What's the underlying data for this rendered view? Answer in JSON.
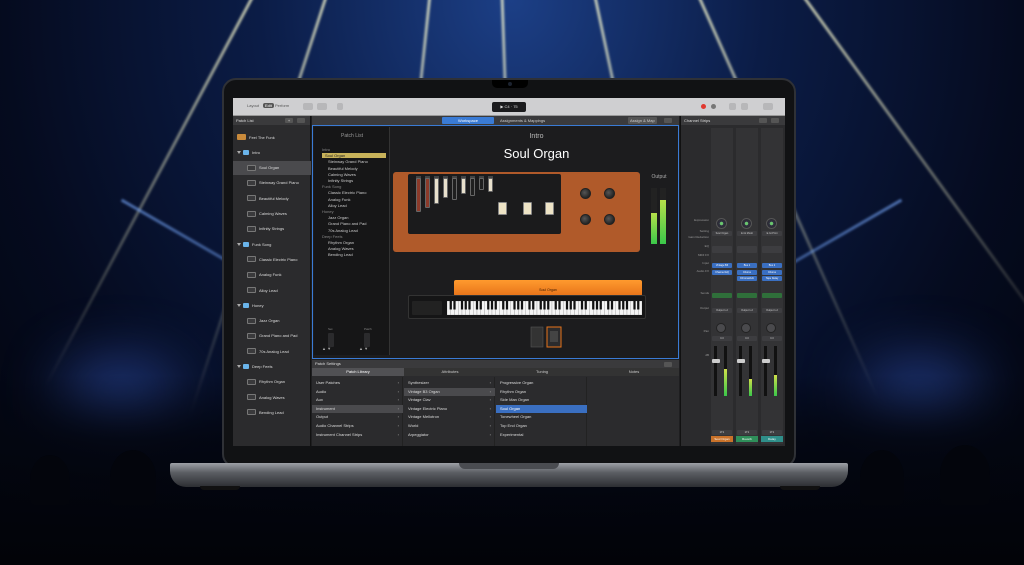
{
  "toolbar": {
    "lcd_text": "▶ C4 · 75",
    "view_segments": [
      "Layout",
      "Edit",
      "Perform"
    ],
    "active_segment": "Edit"
  },
  "patch_list": {
    "title": "Patch List",
    "add_symbol": "+",
    "items": [
      {
        "label": "Feel The Funk",
        "kind": "patch-top",
        "selected": false
      },
      {
        "label": "Intro",
        "kind": "folder",
        "selected": false
      },
      {
        "label": "Soul Organ",
        "kind": "patch",
        "selected": true
      },
      {
        "label": "Steinway Grand Piano",
        "kind": "patch",
        "selected": false
      },
      {
        "label": "Beautiful Melody",
        "kind": "patch",
        "selected": false
      },
      {
        "label": "Calming Waves",
        "kind": "patch",
        "selected": false
      },
      {
        "label": "Infinity Strings",
        "kind": "patch",
        "selected": false
      },
      {
        "label": "Funk Song",
        "kind": "folder",
        "selected": false
      },
      {
        "label": "Classic Electric Piano",
        "kind": "patch",
        "selected": false
      },
      {
        "label": "Analog Funk",
        "kind": "patch",
        "selected": false
      },
      {
        "label": "Alloy Lead",
        "kind": "patch",
        "selected": false
      },
      {
        "label": "Honey",
        "kind": "folder",
        "selected": false
      },
      {
        "label": "Jazz Organ",
        "kind": "patch",
        "selected": false
      },
      {
        "label": "Grand Piano and Pad",
        "kind": "patch",
        "selected": false
      },
      {
        "label": "70s Analog Lead",
        "kind": "patch",
        "selected": false
      },
      {
        "label": "Deep Feels",
        "kind": "folder",
        "selected": false
      },
      {
        "label": "Rhythm Organ",
        "kind": "patch",
        "selected": false
      },
      {
        "label": "Analog Waves",
        "kind": "patch",
        "selected": false
      },
      {
        "label": "Bending Lead",
        "kind": "patch",
        "selected": false
      }
    ]
  },
  "workspace": {
    "tabs": [
      "Workspace",
      "Assignments & Mappings"
    ],
    "active_tab": "Workspace",
    "right_button": "Assign & Map",
    "inner_list_title": "Patch List",
    "inner_items": [
      {
        "label": "Intro",
        "kind": "hdr"
      },
      {
        "label": "Soul Organ",
        "kind": "sel"
      },
      {
        "label": "Steinway Grand Piano",
        "kind": "item"
      },
      {
        "label": "Beautiful Melody",
        "kind": "item"
      },
      {
        "label": "Calming Waves",
        "kind": "item"
      },
      {
        "label": "Infinity Strings",
        "kind": "item"
      },
      {
        "label": "Funk Song",
        "kind": "hdr"
      },
      {
        "label": "Classic Electric Piano",
        "kind": "item"
      },
      {
        "label": "Analog Funk",
        "kind": "item"
      },
      {
        "label": "Alloy Lead",
        "kind": "item"
      },
      {
        "label": "Honey",
        "kind": "hdr"
      },
      {
        "label": "Jazz Organ",
        "kind": "item"
      },
      {
        "label": "Grand Piano and Pad",
        "kind": "item"
      },
      {
        "label": "70s Analog Lead",
        "kind": "item"
      },
      {
        "label": "Deep Feels",
        "kind": "hdr"
      },
      {
        "label": "Rhythm Organ",
        "kind": "item"
      },
      {
        "label": "Analog Waves",
        "kind": "item"
      },
      {
        "label": "Bending Lead",
        "kind": "item"
      }
    ],
    "set_label": "Set",
    "patch_label": "Patch",
    "section_name": "Intro",
    "patch_name": "Soul Organ",
    "output_label": "Output",
    "keyboard_label": "Soul Organ"
  },
  "patch_settings": {
    "title": "Patch Settings",
    "tabs": [
      "Patch Library",
      "Attributes",
      "Tuning",
      "Notes"
    ],
    "active_tab": "Patch Library",
    "col1": [
      {
        "label": "User Patches",
        "state": ""
      },
      {
        "label": "Audio",
        "state": ""
      },
      {
        "label": "Aux",
        "state": ""
      },
      {
        "label": "Instrument",
        "state": "sel"
      },
      {
        "label": "Output",
        "state": ""
      },
      {
        "label": "Audio Channel Strips",
        "state": ""
      },
      {
        "label": "Instrument Channel Strips",
        "state": ""
      }
    ],
    "col2": [
      {
        "label": "Synthesizer",
        "state": ""
      },
      {
        "label": "Vintage B3 Organ",
        "state": "sel"
      },
      {
        "label": "Vintage Clav",
        "state": ""
      },
      {
        "label": "Vintage Electric Piano",
        "state": ""
      },
      {
        "label": "Vintage Mellotron",
        "state": ""
      },
      {
        "label": "World",
        "state": ""
      },
      {
        "label": "Arpeggiator",
        "state": ""
      }
    ],
    "col3": [
      {
        "label": "Progressive Organ",
        "state": ""
      },
      {
        "label": "Rhythm Organ",
        "state": ""
      },
      {
        "label": "Side Man Organ",
        "state": ""
      },
      {
        "label": "Soul Organ",
        "state": "blue"
      },
      {
        "label": "Tonewheel Organ",
        "state": ""
      },
      {
        "label": "Top End Organ",
        "state": ""
      },
      {
        "label": "Experimental",
        "state": ""
      }
    ]
  },
  "channel_strips": {
    "title": "Channel Strips",
    "row_labels": [
      "Expression",
      "Setting",
      "Gain Reduction",
      "EQ",
      "MIDI FX",
      "Input",
      "Audio FX",
      "Sends",
      "Output",
      "Pan",
      "dB"
    ],
    "strips": [
      {
        "setting": "Soul Organ",
        "input": "Vintage B3",
        "fx1": "Channel EQ",
        "fx2": "",
        "output": "Output 1-2",
        "db": "0.0",
        "name": "Soul Organ",
        "name_color": "#c9722a",
        "level": 0.55
      },
      {
        "setting": "E.Gt Monit",
        "input": "Bus 1",
        "fx1": "Chorus",
        "fx2": "ChromaVerb",
        "output": "Output 1-2",
        "db": "0.0",
        "name": "Reverb",
        "name_color": "#2f8f5a",
        "level": 0.35
      },
      {
        "setting": "E.Gt Print",
        "input": "Bus 2",
        "fx1": "Chorus",
        "fx2": "Tape Delay",
        "output": "Output 1-2",
        "db": "0.0",
        "name": "Delay",
        "name_color": "#2f8f8a",
        "level": 0.42
      }
    ]
  }
}
